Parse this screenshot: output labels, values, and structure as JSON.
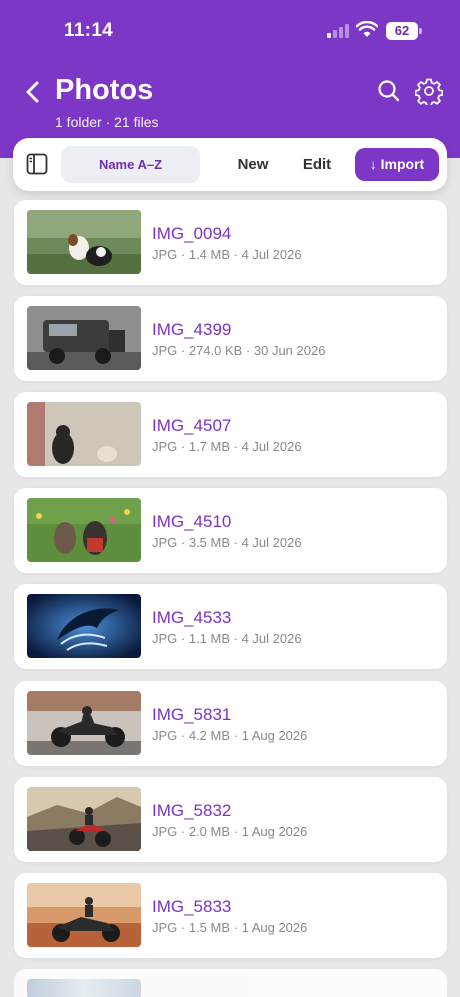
{
  "status_bar": {
    "time": "11:14",
    "battery": "62"
  },
  "header": {
    "title": "Photos",
    "subtitle": "1 folder · 21 files"
  },
  "toolbar": {
    "sort_label": "Name A–Z",
    "new_label": "New",
    "edit_label": "Edit",
    "import_label": "↓ Import"
  },
  "colors": {
    "accent": "#7d37c6",
    "file_name": "#7a34c2",
    "background": "#e7e7e9"
  },
  "files": [
    {
      "name": "IMG_0094",
      "meta": "JPG · 1.4 MB · 4 Jul 2026"
    },
    {
      "name": "IMG_4399",
      "meta": "JPG · 274.0 KB · 30 Jun 2026"
    },
    {
      "name": "IMG_4507",
      "meta": "JPG · 1.7 MB · 4 Jul 2026"
    },
    {
      "name": "IMG_4510",
      "meta": "JPG · 3.5 MB · 4 Jul 2026"
    },
    {
      "name": "IMG_4533",
      "meta": "JPG · 1.1 MB · 4 Jul 2026"
    },
    {
      "name": "IMG_5831",
      "meta": "JPG · 4.2 MB · 1 Aug 2026"
    },
    {
      "name": "IMG_5832",
      "meta": "JPG · 2.0 MB · 1 Aug 2026"
    },
    {
      "name": "IMG_5833",
      "meta": "JPG · 1.5 MB · 1 Aug 2026"
    }
  ]
}
